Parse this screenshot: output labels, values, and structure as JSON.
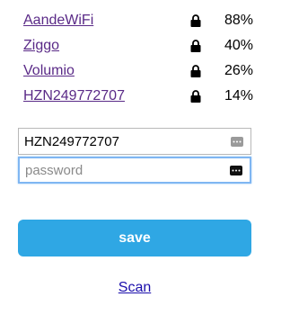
{
  "networks": [
    {
      "ssid": "AandeWiFi",
      "signal": "88%",
      "secured_icon": "lock-icon"
    },
    {
      "ssid": "Ziggo",
      "signal": "40%",
      "secured_icon": "lock-icon"
    },
    {
      "ssid": "Volumio",
      "signal": "26%",
      "secured_icon": "lock-icon"
    },
    {
      "ssid": "HZN249772707",
      "signal": "14%",
      "secured_icon": "lock-icon"
    }
  ],
  "form": {
    "ssid_value": "HZN249772707",
    "password_placeholder": "password",
    "autofill_icon": "keychain-icon",
    "save_label": "save"
  },
  "scan_label": "Scan",
  "colors": {
    "link": "#5a2a87",
    "button": "#2fa7e4",
    "focus": "#7fb6f2"
  }
}
